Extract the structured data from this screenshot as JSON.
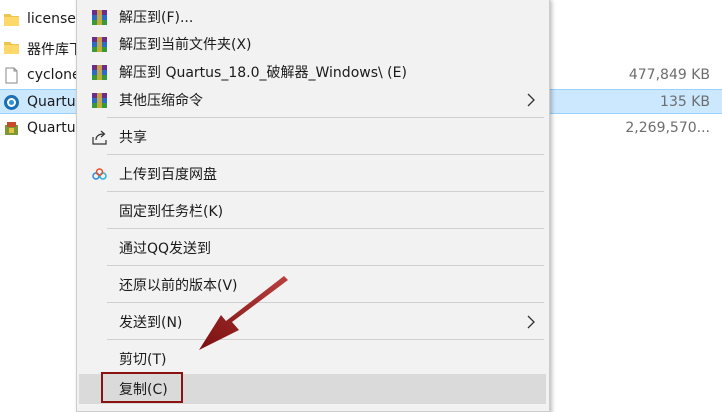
{
  "files": [
    {
      "name": "license",
      "size": "",
      "icon": "folder-icon",
      "selected": false
    },
    {
      "name": "器件库下",
      "size": "",
      "icon": "folder-icon",
      "selected": false
    },
    {
      "name": "cyclone",
      "size": "477,849 KB",
      "icon": "document-icon",
      "selected": false
    },
    {
      "name": "Quartus",
      "size": "135 KB",
      "icon": "quartus-icon",
      "selected": true
    },
    {
      "name": "Quartus",
      "size": "2,269,570...",
      "icon": "installer-icon",
      "selected": false
    }
  ],
  "menu": {
    "items": [
      {
        "id": "extract-to",
        "label": "解压到(F)...",
        "icon": "winrar-icon",
        "submenu": false
      },
      {
        "id": "extract-here",
        "label": "解压到当前文件夹(X)",
        "icon": "winrar-icon",
        "submenu": false
      },
      {
        "id": "extract-to-folder",
        "label": "解压到 Quartus_18.0_破解器_Windows\\ (E)",
        "icon": "winrar-icon",
        "submenu": false
      },
      {
        "id": "other-commands",
        "label": "其他压缩命令",
        "icon": "winrar-icon",
        "submenu": true
      },
      {
        "id": "share",
        "label": "共享",
        "icon": "share-icon",
        "submenu": false
      },
      {
        "id": "upload-baidu",
        "label": "上传到百度网盘",
        "icon": "baidu-netdisk-icon",
        "submenu": false
      },
      {
        "id": "pin-taskbar",
        "label": "固定到任务栏(K)",
        "icon": "",
        "submenu": false
      },
      {
        "id": "send-qq",
        "label": "通过QQ发送到",
        "icon": "",
        "submenu": false
      },
      {
        "id": "restore-versions",
        "label": "还原以前的版本(V)",
        "icon": "",
        "submenu": false
      },
      {
        "id": "send-to",
        "label": "发送到(N)",
        "icon": "",
        "submenu": true
      },
      {
        "id": "cut",
        "label": "剪切(T)",
        "icon": "",
        "submenu": false
      },
      {
        "id": "copy",
        "label": "复制(C)",
        "icon": "",
        "submenu": false
      }
    ]
  },
  "colors": {
    "selection": "#cce8ff",
    "menu_bg": "#f2f2f2",
    "menu_highlight": "#dadada",
    "annotation": "#8b1212"
  }
}
